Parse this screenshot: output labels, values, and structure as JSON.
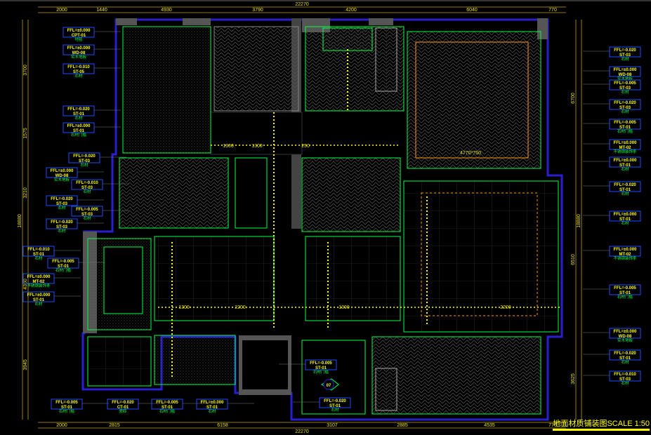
{
  "title": "地面材质铺装图SCALE 1:50",
  "dims_top": {
    "total": "22270",
    "segments": [
      "2000",
      "1440",
      "4930",
      "3790",
      "4200",
      "6040",
      "770"
    ]
  },
  "dims_bottom": {
    "total": "22270",
    "segments": [
      "2000",
      "2815",
      "6158",
      "3107",
      "2885",
      "4535",
      "770"
    ]
  },
  "dims_left": [
    "3700",
    "1575",
    "3210",
    "4360",
    "3945",
    "18880"
  ],
  "dims_right": [
    "6700",
    "6510",
    "3625",
    "18880"
  ],
  "inner_dims": [
    "1300",
    "1300",
    "250",
    "4770*750",
    "1300",
    "2200",
    "1300",
    "2200"
  ],
  "section_mark": "07",
  "tags": [
    {
      "level": "FFL=±0.000",
      "code": "CPT-01",
      "note": "地毯"
    },
    {
      "level": "FFL=±0.000",
      "code": "WD-08",
      "note": "实木地板"
    },
    {
      "level": "FFL=-0.010",
      "code": "ST-05",
      "note": "石材"
    },
    {
      "level": "FFL=-0.020",
      "code": "ST-01",
      "note": "石材"
    },
    {
      "level": "FFL=±0.000",
      "code": "ST-01",
      "note": "石材门槛"
    },
    {
      "level": "FFL=-0.020",
      "code": "ST-03",
      "note": "石材"
    },
    {
      "level": "FFL=±0.000",
      "code": "WD-08",
      "note": "实木地板"
    },
    {
      "level": "FFL=-0.010",
      "code": "ST-03",
      "note": "石材"
    },
    {
      "level": "FFL=-0.020",
      "code": "ST-03",
      "note": "石材"
    },
    {
      "level": "FFL=-0.005",
      "code": "ST-03",
      "note": "石材"
    },
    {
      "level": "FFL=-0.020",
      "code": "ST-03",
      "note": "石材"
    },
    {
      "level": "FFL=-0.010",
      "code": "ST-01",
      "note": "石材"
    },
    {
      "level": "FFL=-0.005",
      "code": "ST-01",
      "note": "石材门槛"
    },
    {
      "level": "FFL=±0.000",
      "code": "MT-02",
      "note": "不锈钢装饰条"
    },
    {
      "level": "FFL=±0.000",
      "code": "ST-01",
      "note": "石材"
    },
    {
      "level": "FFL=-0.005",
      "code": "ST-01",
      "note": "石材门槛"
    },
    {
      "level": "FFL=-0.020",
      "code": "CT-01",
      "note": "瓷砖"
    },
    {
      "level": "FFL=-0.005",
      "code": "ST-01",
      "note": "石材门槛"
    },
    {
      "level": "FFL=±0.000",
      "code": "ST-01",
      "note": "石材"
    },
    {
      "level": "FFL=-0.005",
      "code": "ST-01",
      "note": "石材门槛"
    },
    {
      "level": "FFL=-0.020",
      "code": "ST-01",
      "note": "石材"
    },
    {
      "level": "FFL=-0.020",
      "code": "ST-03",
      "note": "石材"
    },
    {
      "level": "FFL=±0.000",
      "code": "WD-08",
      "note": "实木地板"
    },
    {
      "level": "FFL=-0.005",
      "code": "ST-03",
      "note": "石材"
    },
    {
      "level": "FFL=-0.020",
      "code": "ST-03",
      "note": "石材"
    },
    {
      "level": "FFL=-0.005",
      "code": "ST-01",
      "note": "石材门槛"
    },
    {
      "level": "FFL=±0.000",
      "code": "MT-02",
      "note": "不锈钢装饰条"
    },
    {
      "level": "FFL=±0.000",
      "code": "ST-01",
      "note": "石材"
    },
    {
      "level": "FFL=-0.020",
      "code": "ST-01",
      "note": "石材"
    },
    {
      "level": "FFL=±0.000",
      "code": "ST-01",
      "note": "石材"
    },
    {
      "level": "FFL=±0.000",
      "code": "MT-02",
      "note": "不锈钢装饰条"
    },
    {
      "level": "FFL=-0.005",
      "code": "ST-01",
      "note": "石材门槛"
    },
    {
      "level": "FFL=±0.000",
      "code": "WD-08",
      "note": "实木地板"
    },
    {
      "level": "FFL=-0.020",
      "code": "ST-01",
      "note": "石材"
    },
    {
      "level": "FFL=-0.010",
      "code": "ST-03",
      "note": "石材"
    }
  ]
}
